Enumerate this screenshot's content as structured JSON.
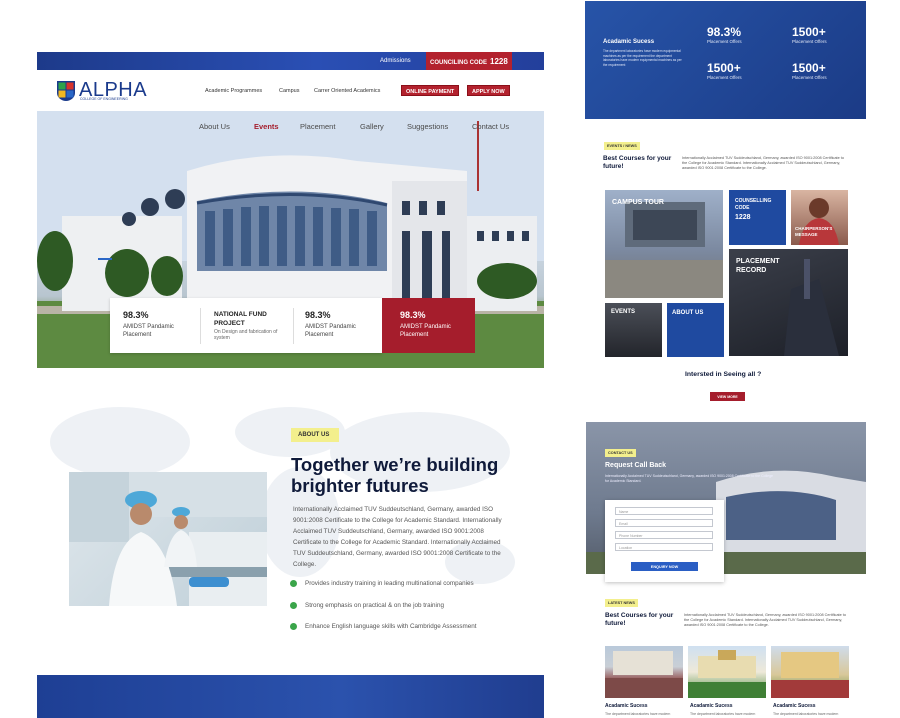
{
  "topbar": {
    "admissions": "Admissions",
    "council_label": "COUNCILING CODE",
    "council_code": "1228"
  },
  "brand": {
    "name": "ALPHA",
    "sub": "COLLEGE OF ENGINEERING"
  },
  "nav": [
    "Academic Programmes",
    "Campus",
    "Carrer Oriented Academics"
  ],
  "buttons": {
    "pay": "ONLINE PAYMENT",
    "apply": "APPLY NOW"
  },
  "hero_nav": [
    "About Us",
    "Events",
    "Placement",
    "Gallery",
    "Suggestions",
    "Contact Us"
  ],
  "hero_nav_active": 1,
  "stats": [
    {
      "value": "98.3%",
      "label": "AMIDST Pandamic Placement"
    },
    {
      "value": "NATIONAL FUND PROJECT",
      "label": "On Design and fabrication of system"
    },
    {
      "value": "98.3%",
      "label": "AMIDST Pandamic Placement"
    },
    {
      "value": "98.3%",
      "label": "AMIDST Pandamic Placement"
    }
  ],
  "about": {
    "tag": "ABOUT US",
    "title": "Together we’re building brighter futures",
    "body": "Internationally Acclaimed TUV Suddeutschland, Germany, awarded ISO 9001:2008 Certificate to the College for Academic Standard. Internationally Acclaimed TUV Suddeutschland, Germany, awarded ISO 9001:2008 Certificate to the College for Academic Standard. Internationally Acclaimed TUV Suddeutschland, Germany, awarded ISO 9001:2008 Certificate to the College.",
    "bullets": [
      "Provides industry training in leading multinational companies",
      "Strong emphasis on practical & on the job training",
      "Enhance English language skills with Cambridge Assessment"
    ]
  },
  "right": {
    "academic": {
      "title": "Acadamic Sucess",
      "text": "The department laboratories have modern equipmental machines as per the requirement the department laboratories have modern equipmental machines as per the requirement",
      "figures": [
        {
          "value": "98.3%",
          "label": "Placement Offers"
        },
        {
          "value": "1500+",
          "label": "Placement Offers"
        },
        {
          "value": "1500+",
          "label": "Placement Offers"
        },
        {
          "value": "1500+",
          "label": "Placement Offers"
        }
      ]
    },
    "events_tag": "EVENTS / NEWS",
    "best_courses": "Best Courses for your future!",
    "fine_print": "Internationally Acclaimed TUV Suddeutschland, Germany, awarded ISO 9001:2008 Certificate to the College for Academic Standard. Internationally Acclaimed TUV Suddeutschland, Germany, awarded ISO 9001:2008 Certificate to the College.",
    "tiles": {
      "campus": "CAMPUS TOUR",
      "counselling": "COUNSELLING CODE",
      "counselling_code": "1228",
      "chair": "CHAIRPERSON'S MESSAGE",
      "placement": "PLACEMENT RECORD",
      "events": "EVENTS",
      "about": "ABOUT US"
    },
    "interested": "Intersted in Seeing all ?",
    "view_more": "VIEW MORE",
    "contact": {
      "tag": "CONTACT US",
      "title": "Request Call Back",
      "text": "Internationally Acclaimed TUV Suddeutschland, Germany, awarded ISO 9001:2008 Certificate to the College for Academic Standard.",
      "fields": [
        "Name",
        "Email",
        "Phone Number",
        "Location"
      ],
      "submit": "ENQUIRY NOW"
    },
    "latest_tag": "LATEST NEWS",
    "cards": [
      {
        "title": "Acadamic Sucess",
        "text": "The department laboratories have modern"
      },
      {
        "title": "Acadamic Sucess",
        "text": "The department laboratories have modern"
      },
      {
        "title": "Acadamic Sucess",
        "text": "The department laboratories have modern"
      }
    ]
  }
}
